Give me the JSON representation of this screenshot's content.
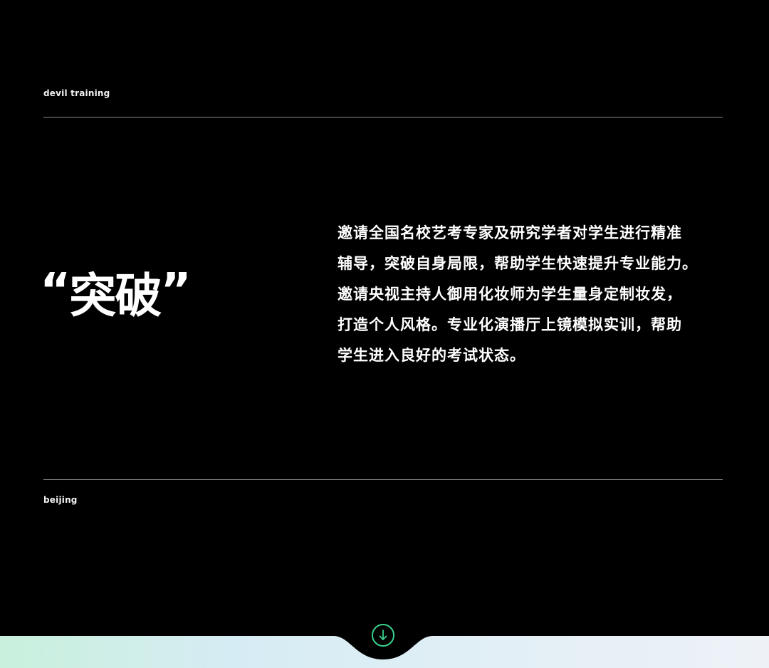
{
  "header": {
    "label": "devil training"
  },
  "headline": {
    "open_quote": "“",
    "text": "突破",
    "close_quote": "”"
  },
  "body": {
    "lines": [
      "邀请全国名校艺考专家及研究学者对学生进行精准",
      "辅导，突破自身局限，帮助学生快速提升专业能力。",
      "邀请央视主持人御用化妆师为学生量身定制妆发，",
      "打造个人风格。专业化演播厅上镜模拟实训，帮助",
      "学生进入良好的考试状态。"
    ]
  },
  "footer": {
    "label": "beijing",
    "scroll_icon": "arrow-down-icon"
  },
  "colors": {
    "background": "#000000",
    "text": "#ffffff",
    "divider": "#8a8a8a",
    "accent": "#39d28f",
    "footer_gradient_start": "#c8f0dc",
    "footer_gradient_end": "#eef2f7"
  }
}
